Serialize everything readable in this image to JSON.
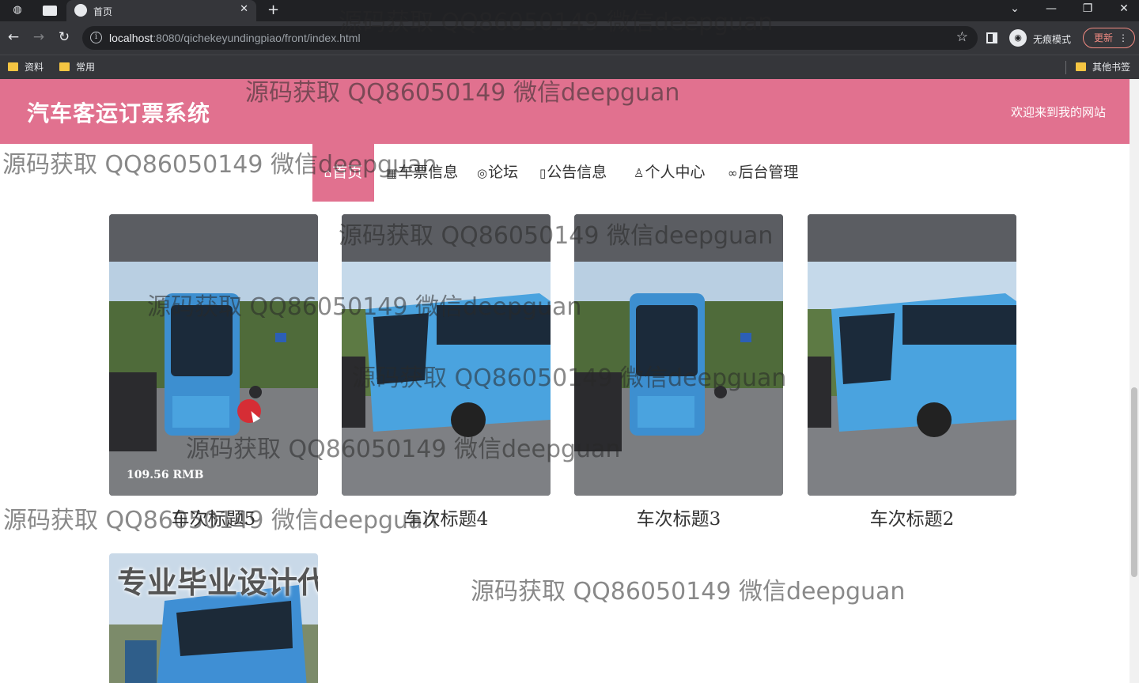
{
  "browser": {
    "tab_title": "首页",
    "url_host": "localhost",
    "url_rest": ":8080/qichekeyundingpiao/front/index.html",
    "incognito_label": "无痕模式",
    "update_label": "更新",
    "bookmarks": [
      "资料",
      "常用"
    ],
    "other_bookmarks": "其他书签"
  },
  "site": {
    "title": "汽车客运订票系统",
    "welcome": "欢迎来到我的网站"
  },
  "nav": [
    {
      "label": "首页",
      "icon": "home-icon",
      "active": true
    },
    {
      "label": "车票信息",
      "icon": "grid-icon",
      "active": false
    },
    {
      "label": "论坛",
      "icon": "palette-icon",
      "active": false
    },
    {
      "label": "公告信息",
      "icon": "clipboard-icon",
      "active": false
    },
    {
      "label": "个人中心",
      "icon": "user-icon",
      "active": false
    },
    {
      "label": "后台管理",
      "icon": "link-icon",
      "active": false
    }
  ],
  "cards": [
    {
      "title": "车次标题5",
      "price": "109.56 RMB"
    },
    {
      "title": "车次标题4"
    },
    {
      "title": "车次标题3"
    },
    {
      "title": "车次标题2"
    }
  ],
  "promo": {
    "text": "专业毕业设计代做"
  },
  "watermark": "源码获取 QQ86050149 微信deepguan",
  "colors": {
    "header_pink": "#e1718f",
    "bus_blue": "#4aa3df"
  }
}
